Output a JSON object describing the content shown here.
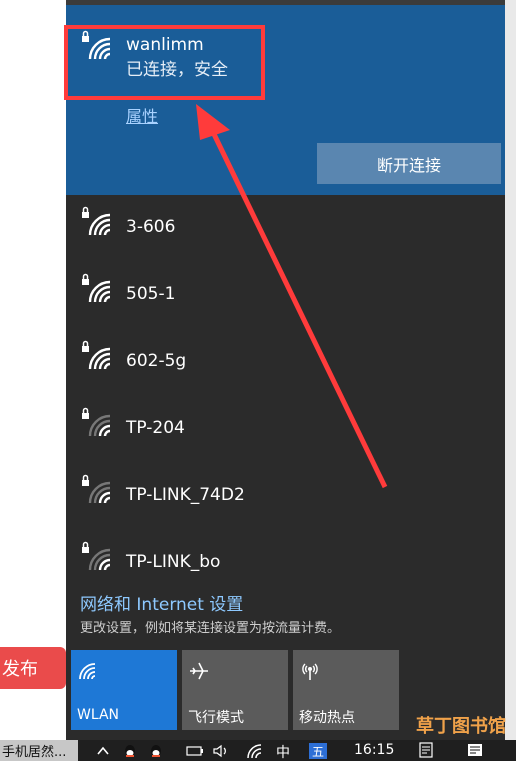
{
  "background": {
    "publish_label": "发布",
    "taskbar_app_label": "手机居然..."
  },
  "panel": {
    "connected": {
      "name": "wanlimm",
      "status": "已连接，安全",
      "properties_label": "属性",
      "disconnect_label": "断开连接"
    },
    "networks": [
      {
        "name": "3-606",
        "signal": 4
      },
      {
        "name": "505-1",
        "signal": 4
      },
      {
        "name": "602-5g",
        "signal": 4
      },
      {
        "name": "TP-204",
        "signal": 2
      },
      {
        "name": "TP-LINK_74D2",
        "signal": 2
      },
      {
        "name": "TP-LINK_bo",
        "signal": 2
      }
    ],
    "settings": {
      "link_label": "网络和 Internet 设置",
      "description": "更改设置，例如将某连接设置为按流量计费。"
    },
    "quick_actions": [
      {
        "label": "WLAN",
        "active": true,
        "icon": "wifi-icon"
      },
      {
        "label": "飞行模式",
        "active": false,
        "icon": "airplane-icon"
      },
      {
        "label": "移动热点",
        "active": false,
        "icon": "hotspot-icon"
      }
    ]
  },
  "taskbar": {
    "ime_cn": "中",
    "ime_wubi": "五",
    "time": "16:15"
  },
  "watermark": "草丁图书馆",
  "colors": {
    "accent": "#1a5d98",
    "highlight": "#ff3b3b",
    "tile_active": "#1e78d6",
    "panel_bg": "#2b2b2b"
  }
}
